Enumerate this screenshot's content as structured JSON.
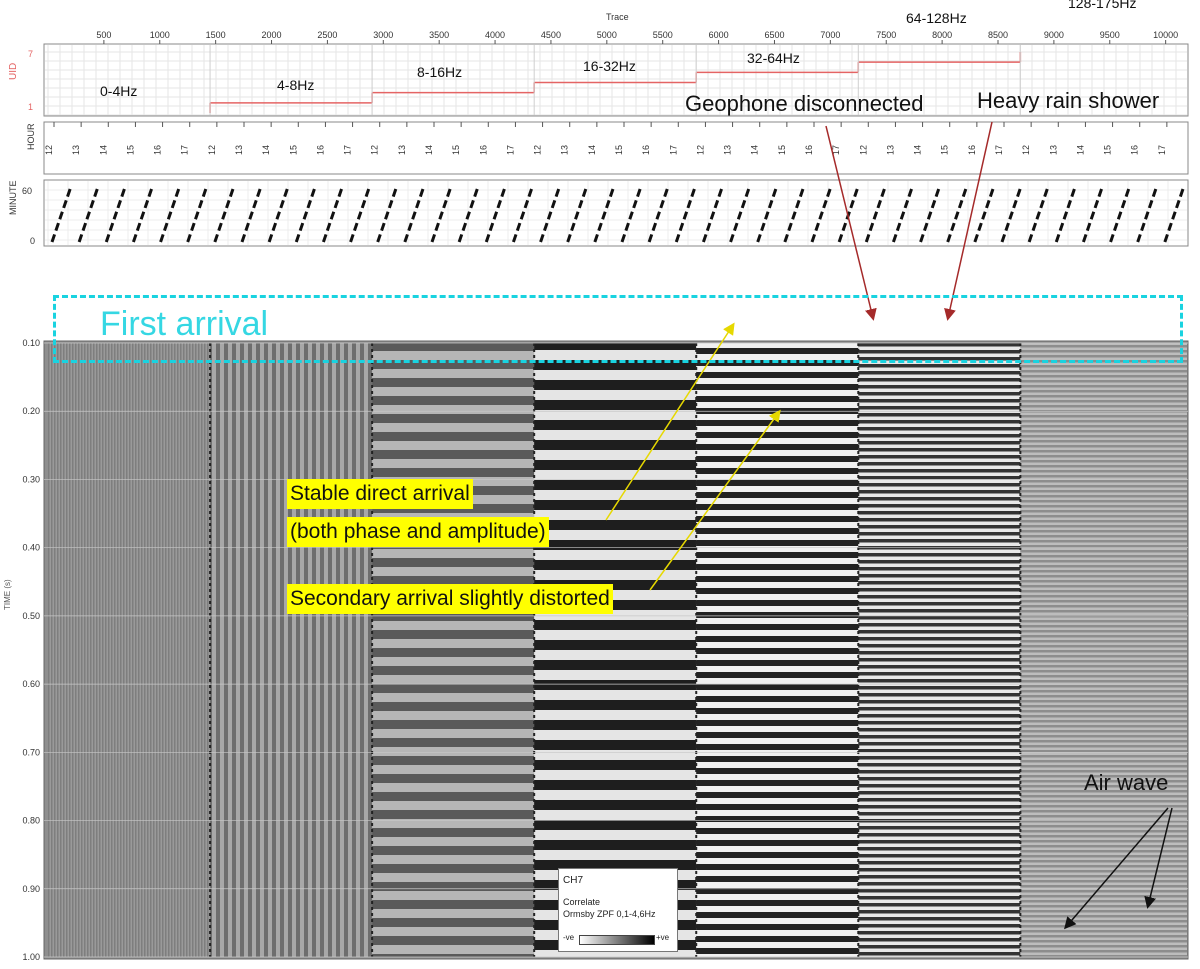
{
  "chart_data": {
    "type": "heatmap",
    "trace_axis": {
      "label": "Trace",
      "ticks": [
        "500",
        "1000",
        "1500",
        "2000",
        "2500",
        "3000",
        "3500",
        "4000",
        "4500",
        "5000",
        "5500",
        "6000",
        "6500",
        "7000",
        "7500",
        "8000",
        "8500",
        "9000",
        "9500",
        "10000"
      ],
      "range": [
        0,
        10200
      ]
    },
    "uid_axis": {
      "label": "UID",
      "ticks": [
        "7",
        "1"
      ]
    },
    "hour_axis": {
      "label": "HOUR",
      "cycle_labels": [
        "12",
        "13",
        "14",
        "15",
        "16",
        "17"
      ],
      "cycles": 7
    },
    "minute_axis": {
      "label": "MINUTE",
      "ticks": [
        "60",
        "0"
      ]
    },
    "time_axis": {
      "label": "TIME (s)",
      "ticks": [
        "0.10",
        "0.20",
        "0.30",
        "0.40",
        "0.50",
        "0.60",
        "0.70",
        "0.80",
        "0.90",
        "1.00"
      ],
      "range": [
        0.1,
        1.0
      ]
    },
    "frequency_bands": [
      {
        "label": "0-4Hz",
        "trace_start": 0,
        "trace_end": 1450,
        "uid": 1
      },
      {
        "label": "4-8Hz",
        "trace_start": 1450,
        "trace_end": 2900,
        "uid": 2
      },
      {
        "label": "8-16Hz",
        "trace_start": 2900,
        "trace_end": 4350,
        "uid": 3
      },
      {
        "label": "16-32Hz",
        "trace_start": 4350,
        "trace_end": 5800,
        "uid": 4
      },
      {
        "label": "32-64Hz",
        "trace_start": 5800,
        "trace_end": 7250,
        "uid": 5
      },
      {
        "label": "64-128Hz",
        "trace_start": 7250,
        "trace_end": 8700,
        "uid": 6
      },
      {
        "label": "128-175Hz",
        "trace_start": 8700,
        "trace_end": 10200,
        "uid": 7
      }
    ],
    "annotations": {
      "first_arrival": "First arrival",
      "geophone": "Geophone disconnected",
      "rain": "Heavy rain shower",
      "stable_line1": "Stable direct arrival",
      "stable_line2": "(both phase and amplitude)",
      "secondary": "Secondary arrival slightly distorted",
      "air_wave": "Air wave"
    },
    "legend": {
      "channel": "CH7",
      "line1": "Correlate",
      "line2": "Ormsby ZPF 0,1-4,6Hz",
      "neg": "-ve",
      "pos": "+ve"
    },
    "colors": {
      "uid_line": "#e46464",
      "first_arrival_box": "#19d3e0",
      "annotation_highlight": "#ffff00",
      "red_arrow": "#a52a2a",
      "yellow_arrow": "#e6d800"
    }
  }
}
